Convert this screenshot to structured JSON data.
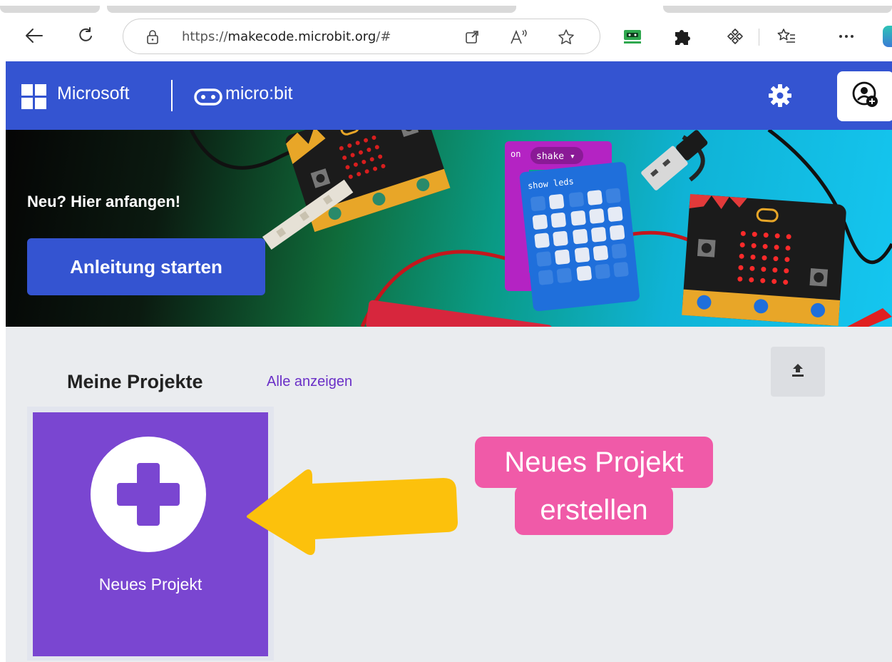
{
  "browser": {
    "url_prefix": "https://",
    "url_domain": "makecode.microbit.org",
    "url_suffix": "/#",
    "icons": [
      "back-icon",
      "refresh-icon",
      "lock-icon",
      "open-app-icon",
      "read-aloud-icon",
      "favorite-icon",
      "extension-app-icon",
      "puzzle-extensions-icon",
      "copilot-icon",
      "favorites-list-icon",
      "more-icon"
    ]
  },
  "header": {
    "brand": "Microsoft",
    "product": "micro:bit",
    "icons": [
      "settings-gear-icon",
      "user-account-icon"
    ]
  },
  "hero": {
    "title": "Neu? Hier anfangen!",
    "button": "Anleitung starten"
  },
  "projects": {
    "heading": "Meine Projekte",
    "see_all": "Alle anzeigen",
    "new_project_label": "Neues Projekt",
    "icons": [
      "import-upload-icon",
      "plus-icon"
    ]
  },
  "annotation": {
    "line1": "Neues Projekt",
    "line2": "erstellen"
  },
  "colors": {
    "header_blue": "#3454d1",
    "card_purple": "#7a46d1",
    "callout_pink": "#f05aa8",
    "arrow_yellow": "#fcc10c"
  }
}
